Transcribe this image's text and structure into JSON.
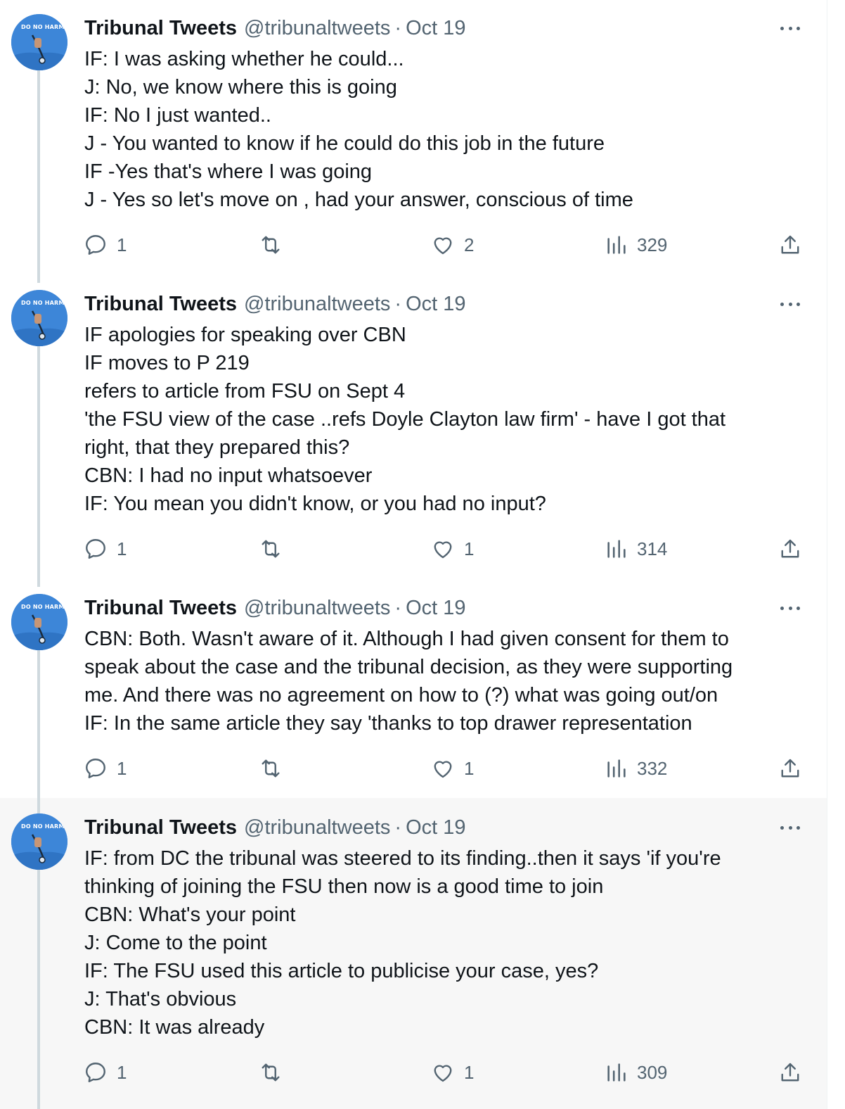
{
  "tweets": [
    {
      "author": {
        "name": "Tribunal Tweets",
        "handle": "@tribunaltweets",
        "avatar_label": "DO NO HARM"
      },
      "separator": "·",
      "date": "Oct 19",
      "lines": [
        "IF: I was asking whether he could...",
        "J: No, we know where this is going",
        "IF: No I just wanted..",
        "J - You wanted to know if he could do this job in the future",
        "IF -Yes that's where I was going",
        "J - Yes so let's move on , had your answer, conscious of time"
      ],
      "stats": {
        "replies": "1",
        "retweets": "",
        "likes": "2",
        "views": "329"
      }
    },
    {
      "author": {
        "name": "Tribunal Tweets",
        "handle": "@tribunaltweets",
        "avatar_label": "DO NO HARM"
      },
      "separator": "·",
      "date": "Oct 19",
      "lines": [
        "IF apologies for speaking over CBN",
        "IF moves to P 219",
        "refers to article from FSU on Sept 4",
        "'the FSU view of the case ..refs Doyle Clayton law firm' - have I got that",
        "right, that they prepared this?",
        "CBN: I had no input whatsoever",
        "IF: You mean you didn't know, or you had no input?"
      ],
      "stats": {
        "replies": "1",
        "retweets": "",
        "likes": "1",
        "views": "314"
      }
    },
    {
      "author": {
        "name": "Tribunal Tweets",
        "handle": "@tribunaltweets",
        "avatar_label": "DO NO HARM"
      },
      "separator": "·",
      "date": "Oct 19",
      "lines": [
        "CBN: Both. Wasn't aware of it. Although I had given consent for them to",
        "speak about the case and the tribunal decision, as they were supporting",
        "me. And there was no agreement on how to (?) what was going out/on",
        "IF: In the same article they say 'thanks to top drawer representation"
      ],
      "stats": {
        "replies": "1",
        "retweets": "",
        "likes": "1",
        "views": "332"
      }
    },
    {
      "author": {
        "name": "Tribunal Tweets",
        "handle": "@tribunaltweets",
        "avatar_label": "DO NO HARM"
      },
      "separator": "·",
      "date": "Oct 19",
      "lines": [
        "IF: from DC the tribunal was steered to its finding..then it says 'if you're",
        "thinking of joining the FSU then now is a good time to join",
        "CBN: What's your point",
        "J: Come to the point",
        "IF: The FSU used this article to publicise your case, yes?",
        "J: That's obvious",
        "CBN: It was already"
      ],
      "stats": {
        "replies": "1",
        "retweets": "",
        "likes": "1",
        "views": "309"
      }
    }
  ],
  "icons": {
    "reply": "reply-icon",
    "retweet": "retweet-icon",
    "like": "heart-icon",
    "views": "views-chart-icon",
    "share": "share-icon",
    "more": "more-options-icon"
  },
  "colors": {
    "text": "#0f1419",
    "secondary": "#536471",
    "thread_line": "#cfd9de",
    "avatar_bg": "#3d86d8",
    "highlight_bg": "#f7f7f7"
  }
}
